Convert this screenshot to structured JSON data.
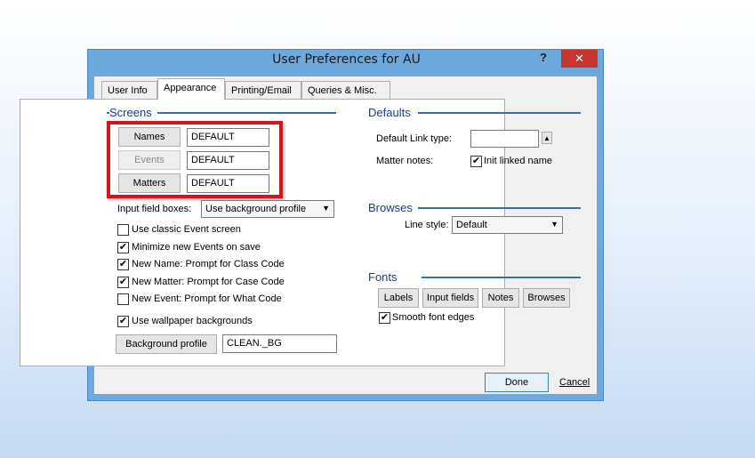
{
  "window": {
    "title": "User Preferences for AU",
    "help": "?",
    "close": "✕"
  },
  "tabs": [
    {
      "label": "User Info"
    },
    {
      "label": "Appearance"
    },
    {
      "label": "Printing/Email"
    },
    {
      "label": "Queries & Misc."
    }
  ],
  "screens": {
    "heading": "Screens",
    "rows": [
      {
        "button": "Names",
        "value": "DEFAULT"
      },
      {
        "button": "Events",
        "value": "DEFAULT"
      },
      {
        "button": "Matters",
        "value": "DEFAULT"
      }
    ],
    "input_field_boxes_label": "Input field boxes:",
    "input_field_boxes_value": "Use background profile",
    "options": [
      {
        "label": "Use classic Event screen",
        "checked": false
      },
      {
        "label": "Minimize new Events on save",
        "checked": true
      },
      {
        "label": "New Name: Prompt for Class Code",
        "checked": true
      },
      {
        "label": "New Matter: Prompt for Case Code",
        "checked": true
      },
      {
        "label": "New Event: Prompt for What Code",
        "checked": false
      },
      {
        "label": "Use wallpaper backgrounds",
        "checked": true
      }
    ],
    "background_profile_button": "Background profile",
    "background_profile_value": "CLEAN._BG"
  },
  "defaults": {
    "heading": "Defaults",
    "link_type_label": "Default Link type:",
    "link_type_value": "",
    "matter_notes_label": "Matter notes:",
    "init_linked_name": {
      "label": "Init linked name",
      "checked": true
    }
  },
  "browses": {
    "heading": "Browses",
    "line_style_label": "Line style:",
    "line_style_value": "Default"
  },
  "fonts": {
    "heading": "Fonts",
    "buttons": [
      "Labels",
      "Input fields",
      "Notes",
      "Browses"
    ],
    "smooth": {
      "label": "Smooth font edges",
      "checked": true
    }
  },
  "footer": {
    "done": "Done",
    "cancel": "Cancel"
  },
  "check_mark": "✔"
}
